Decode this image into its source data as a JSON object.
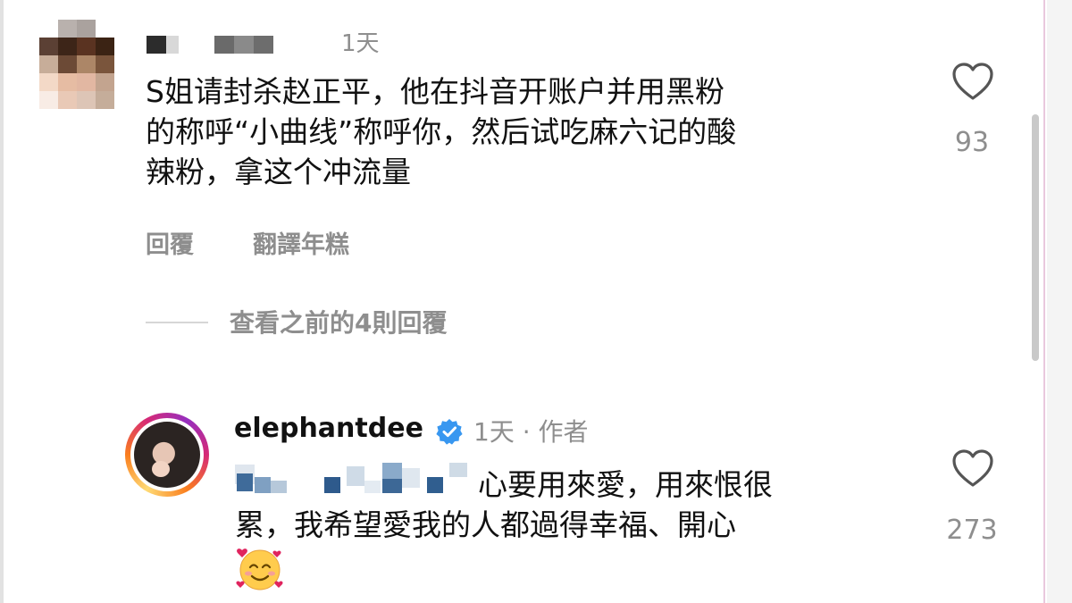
{
  "comment1": {
    "time": "1天",
    "text_lines": [
      "S姐请封杀赵正平，他在抖音开账户并用黑粉",
      "的称呼“小曲线”称呼你，然后试吃麻六记的酸",
      "辣粉，拿这个冲流量"
    ],
    "actions": {
      "reply": "回覆",
      "translate": "翻譯年糕"
    },
    "likes": "93"
  },
  "view_replies": "查看之前的4則回覆",
  "reply": {
    "username": "elephantdee",
    "meta": "1天 · 作者",
    "text_lines": [
      "心要用來愛，用來恨很",
      "累，我希望愛我的人都過得幸福、開心"
    ],
    "likes": "273"
  },
  "icons": {
    "like": "heart-outline-icon",
    "verified": "verified-badge-icon",
    "emoji": "smiling-face-with-hearts-icon"
  },
  "colors": {
    "secondary_text": "#8e8e8e",
    "verified_blue": "#3897f0"
  }
}
